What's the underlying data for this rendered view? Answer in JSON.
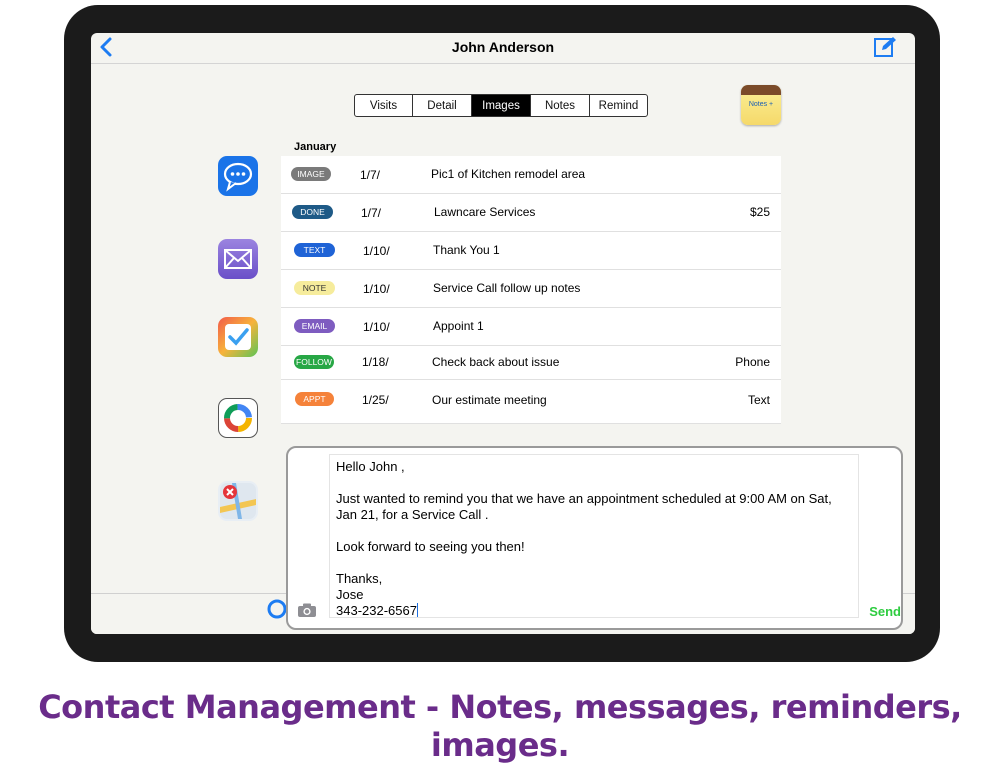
{
  "nav": {
    "title": "John Anderson"
  },
  "tabs": [
    {
      "label": "Visits",
      "active": false
    },
    {
      "label": "Detail",
      "active": false
    },
    {
      "label": "Images",
      "active": true
    },
    {
      "label": "Notes",
      "active": false
    },
    {
      "label": "Remind",
      "active": false
    }
  ],
  "notes_button": {
    "label": "Notes +"
  },
  "side_icons": [
    "message-icon",
    "mail-icon",
    "checklist-icon",
    "photos-icon",
    "maps-icon"
  ],
  "list": {
    "month": "January",
    "rows": [
      {
        "badge": "IMAGE",
        "badge_color": "#7a7a7a",
        "badge_text_color": "#ffffff",
        "date": "1/7/",
        "desc": "Pic1 of Kitchen remodel area",
        "extra": ""
      },
      {
        "badge": "DONE",
        "badge_color": "#1e5a87",
        "badge_text_color": "#ffffff",
        "date": "1/7/",
        "desc": "Lawncare Services",
        "extra": "$25"
      },
      {
        "badge": "TEXT",
        "badge_color": "#1f63d6",
        "badge_text_color": "#ffffff",
        "date": "1/10/",
        "desc": "Thank You 1",
        "extra": ""
      },
      {
        "badge": "NOTE",
        "badge_color": "#f6ec9c",
        "badge_text_color": "#333333",
        "date": "1/10/",
        "desc": "Service Call follow up notes",
        "extra": ""
      },
      {
        "badge": "EMAIL",
        "badge_color": "#7e5cc0",
        "badge_text_color": "#ffffff",
        "date": "1/10/",
        "desc": "Appoint 1",
        "extra": ""
      },
      {
        "badge": "FOLLOW",
        "badge_color": "#27a745",
        "badge_text_color": "#ffffff",
        "date": "1/18/",
        "desc": "Check back about issue",
        "extra": "Phone"
      },
      {
        "badge": "APPT",
        "badge_color": "#f5823a",
        "badge_text_color": "#ffffff",
        "date": "1/25/",
        "desc": "Our estimate meeting",
        "extra": "Text"
      }
    ]
  },
  "compose": {
    "greeting": "Hello John ,",
    "body": "Just wanted to remind you that we have an appointment scheduled at 9:00 AM on Sat, Jan 21, for a Service Call .",
    "closing": "Look forward to seeing you then!",
    "signoff": "Thanks,",
    "name": "Jose",
    "phone": "343-232-6567",
    "send_label": "Send"
  },
  "caption": "Contact Management - Notes, messages, reminders, images."
}
